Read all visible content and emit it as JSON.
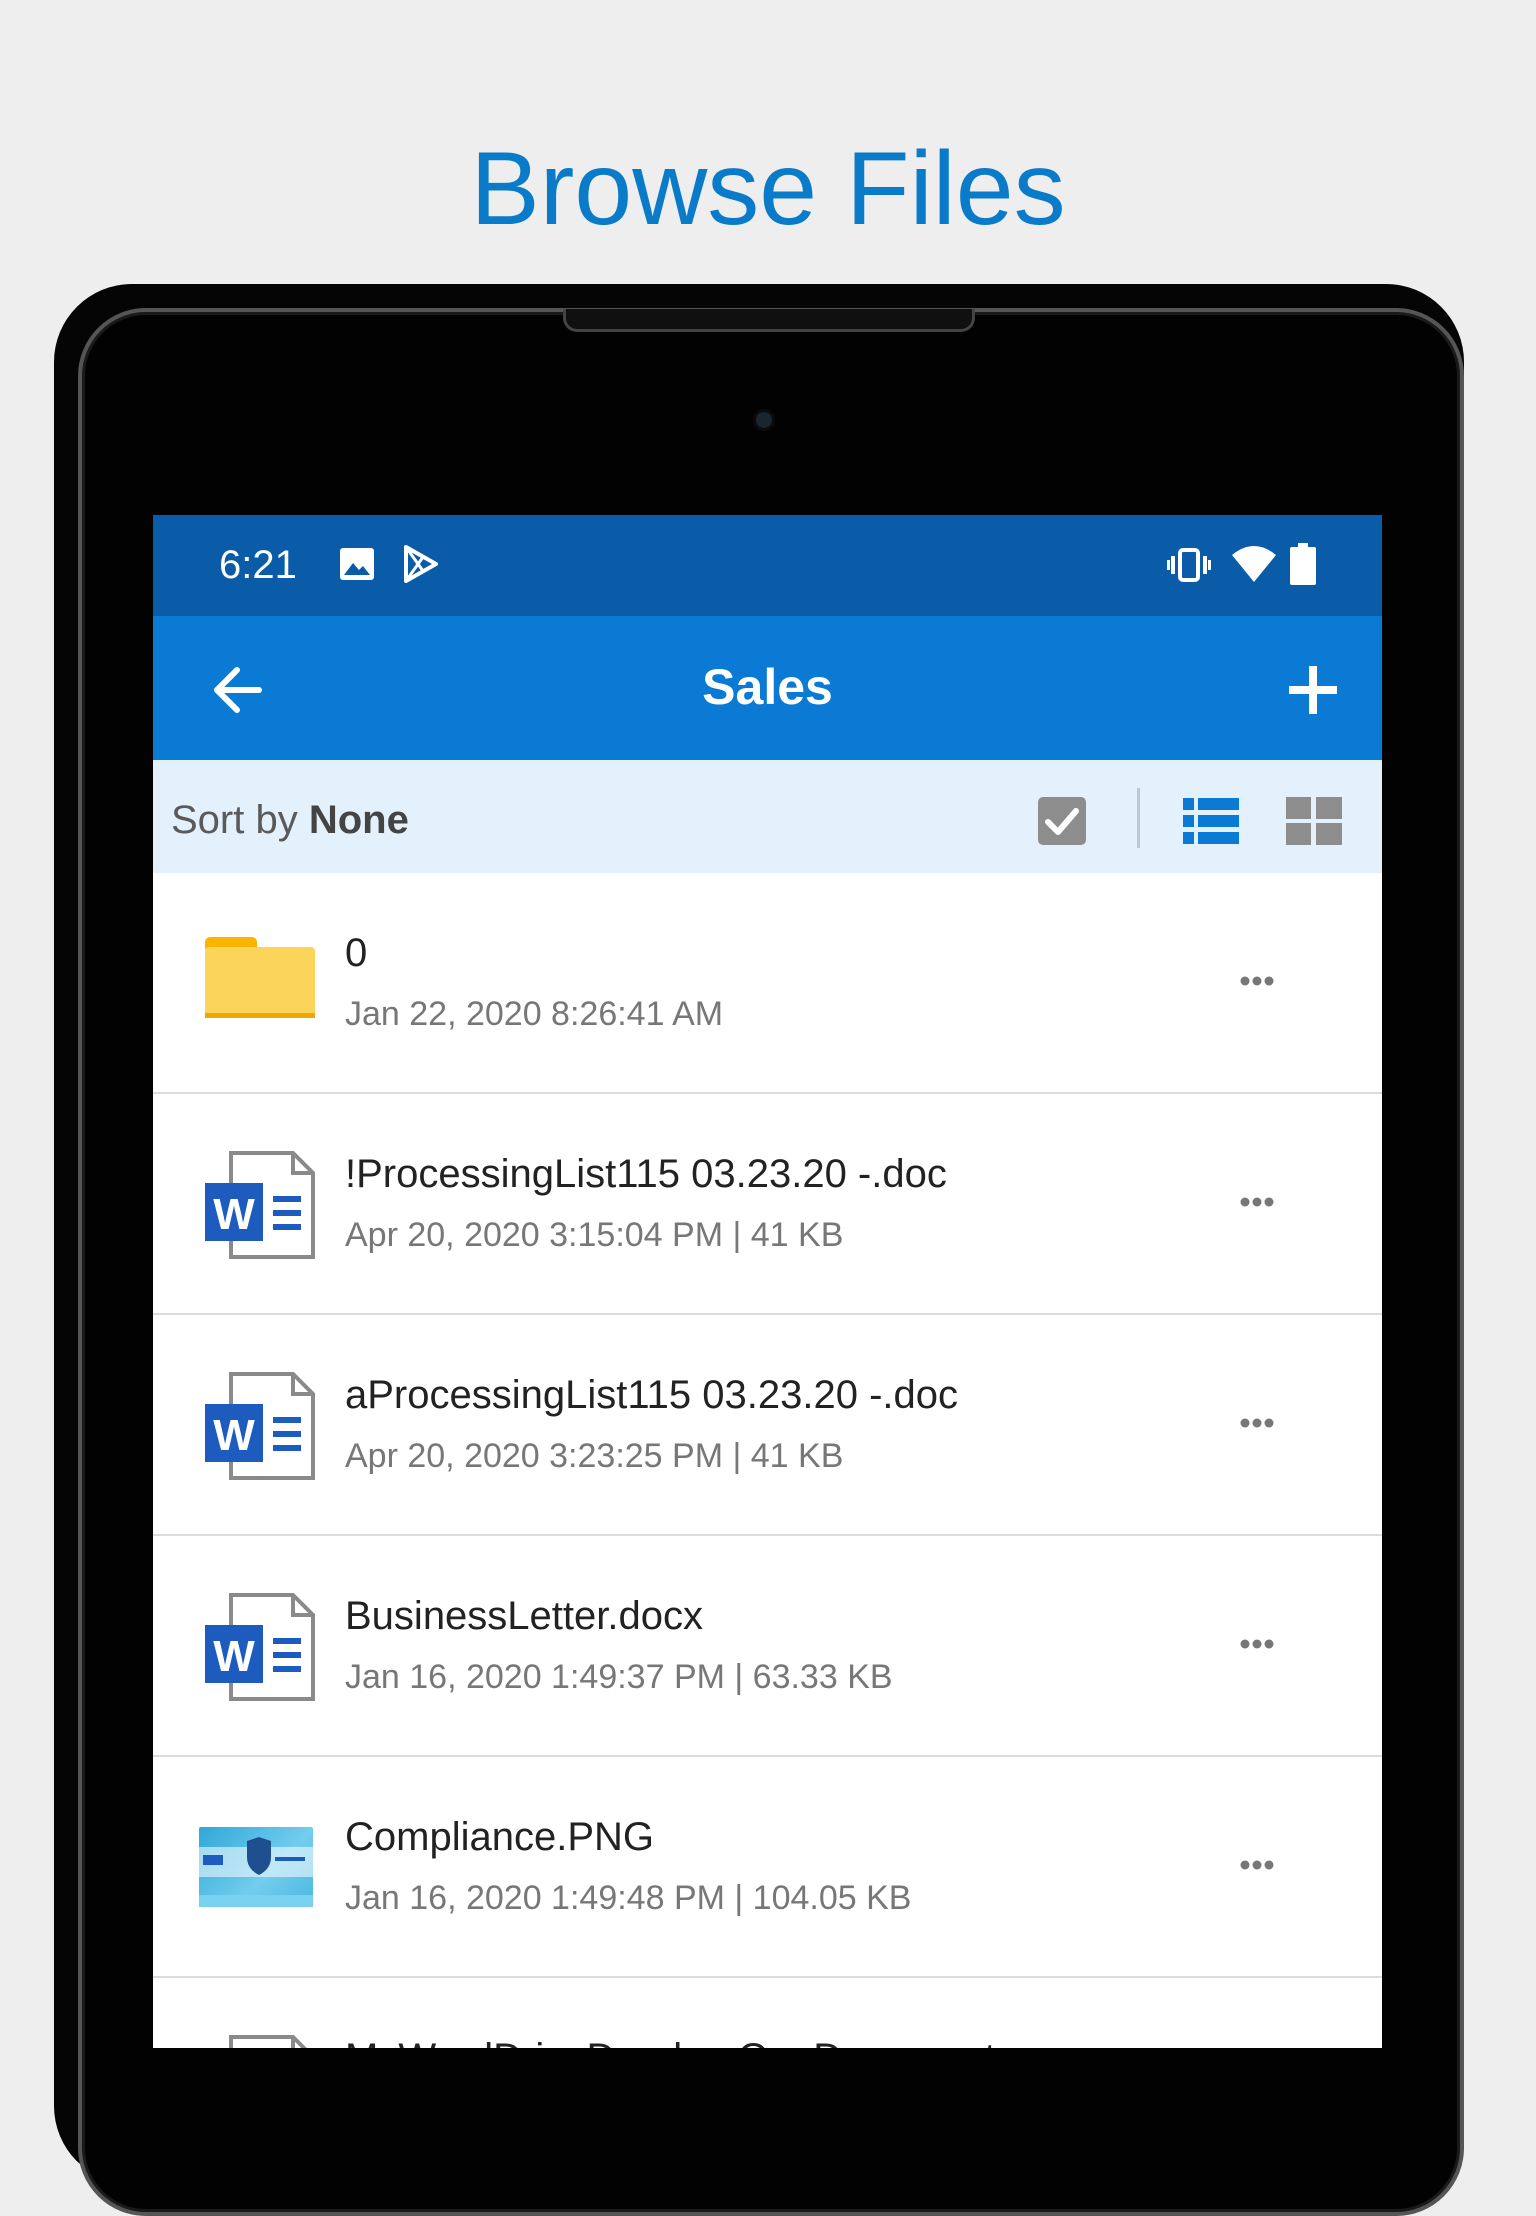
{
  "headline": "Browse Files",
  "status_bar": {
    "time": "6:21",
    "icons": [
      "image-icon",
      "play-store-icon",
      "vibrate-icon",
      "wifi-icon",
      "battery-icon"
    ]
  },
  "app_bar": {
    "title": "Sales",
    "back_icon": "arrow-left-icon",
    "add_icon": "plus-icon"
  },
  "sort_bar": {
    "prefix": "Sort by",
    "value": "None"
  },
  "colors": {
    "status_bar": "#0a5ca8",
    "app_bar": "#0a7ad4",
    "sort_bar": "#e3f1fd",
    "headline": "#0a7bc8",
    "word_blue": "#1e5bbf",
    "folder": "#fbd55a"
  },
  "files": [
    {
      "type": "folder",
      "icon": "folder-icon",
      "name": "0",
      "meta": "Jan 22, 2020 8:26:41 AM"
    },
    {
      "type": "word",
      "icon": "word-doc-icon",
      "name": "!ProcessingList115 03.23.20 -.doc",
      "meta": "Apr 20, 2020 3:15:04 PM | 41 KB"
    },
    {
      "type": "word",
      "icon": "word-doc-icon",
      "name": "aProcessingList115 03.23.20 -.doc",
      "meta": "Apr 20, 2020 3:23:25 PM | 41 KB"
    },
    {
      "type": "word",
      "icon": "word-doc-icon",
      "name": "BusinessLetter.docx",
      "meta": "Jan 16, 2020 1:49:37 PM | 63.33 KB"
    },
    {
      "type": "image",
      "icon": "image-thumbnail",
      "name": "Compliance.PNG",
      "meta": "Jan 16, 2020 1:49:48 PM | 104.05 KB"
    },
    {
      "type": "word",
      "icon": "word-doc-icon",
      "name": "MsWordDriveDropboxOneDocument",
      "meta": ""
    }
  ]
}
